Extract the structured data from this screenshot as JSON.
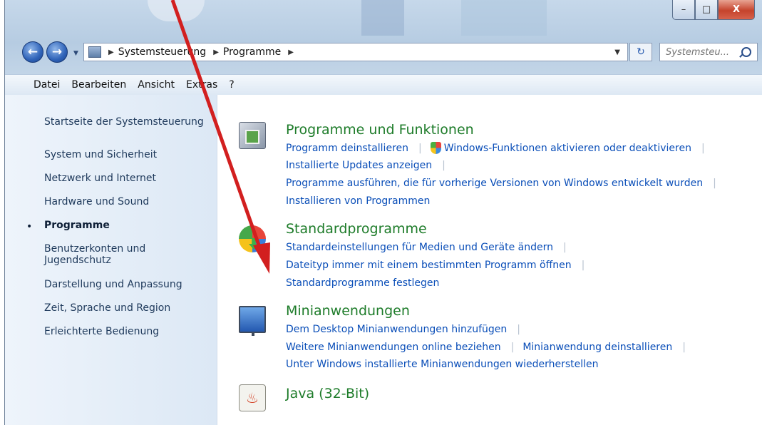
{
  "window": {
    "buttons": {
      "minimize": "–",
      "maximize": "□",
      "close": "X"
    }
  },
  "address": {
    "crumbs": [
      "Systemsteuerung",
      "Programme"
    ],
    "search_placeholder": "Systemsteu..."
  },
  "menu": [
    "Datei",
    "Bearbeiten",
    "Ansicht",
    "Extras",
    "?"
  ],
  "sidebar": {
    "items": [
      {
        "label": "Startseite der Systemsteuerung"
      },
      {
        "label": "System und Sicherheit"
      },
      {
        "label": "Netzwerk und Internet"
      },
      {
        "label": "Hardware und Sound"
      },
      {
        "label": "Programme",
        "current": true
      },
      {
        "label_line1": "Benutzerkonten und",
        "label_line2": "Jugendschutz"
      },
      {
        "label": "Darstellung und Anpassung"
      },
      {
        "label": "Zeit, Sprache und Region"
      },
      {
        "label": "Erleichterte Bedienung"
      }
    ]
  },
  "sections": [
    {
      "title": "Programme und Funktionen",
      "icon": "programs-features-icon",
      "links": [
        "Programm deinstallieren",
        "Windows-Funktionen aktivieren oder deaktivieren",
        "Installierte Updates anzeigen",
        "Programme ausführen, die für vorherige Versionen von Windows entwickelt wurden",
        "Installieren von Programmen"
      ]
    },
    {
      "title": "Standardprogramme",
      "icon": "default-programs-icon",
      "links": [
        "Standardeinstellungen für Medien und Geräte ändern",
        "Dateityp immer mit einem bestimmten Programm öffnen",
        "Standardprogramme festlegen"
      ]
    },
    {
      "title": "Minianwendungen",
      "icon": "gadgets-icon",
      "links": [
        "Dem Desktop Minianwendungen hinzufügen",
        "Weitere Minianwendungen online beziehen",
        "Minianwendung deinstallieren",
        "Unter Windows installierte Minianwendungen wiederherstellen"
      ]
    },
    {
      "title": "Java (32-Bit)",
      "icon": "java-icon"
    }
  ],
  "colors": {
    "section_title": "#1e7c2a",
    "link": "#0a4eb8",
    "arrow": "#d21f1f"
  }
}
